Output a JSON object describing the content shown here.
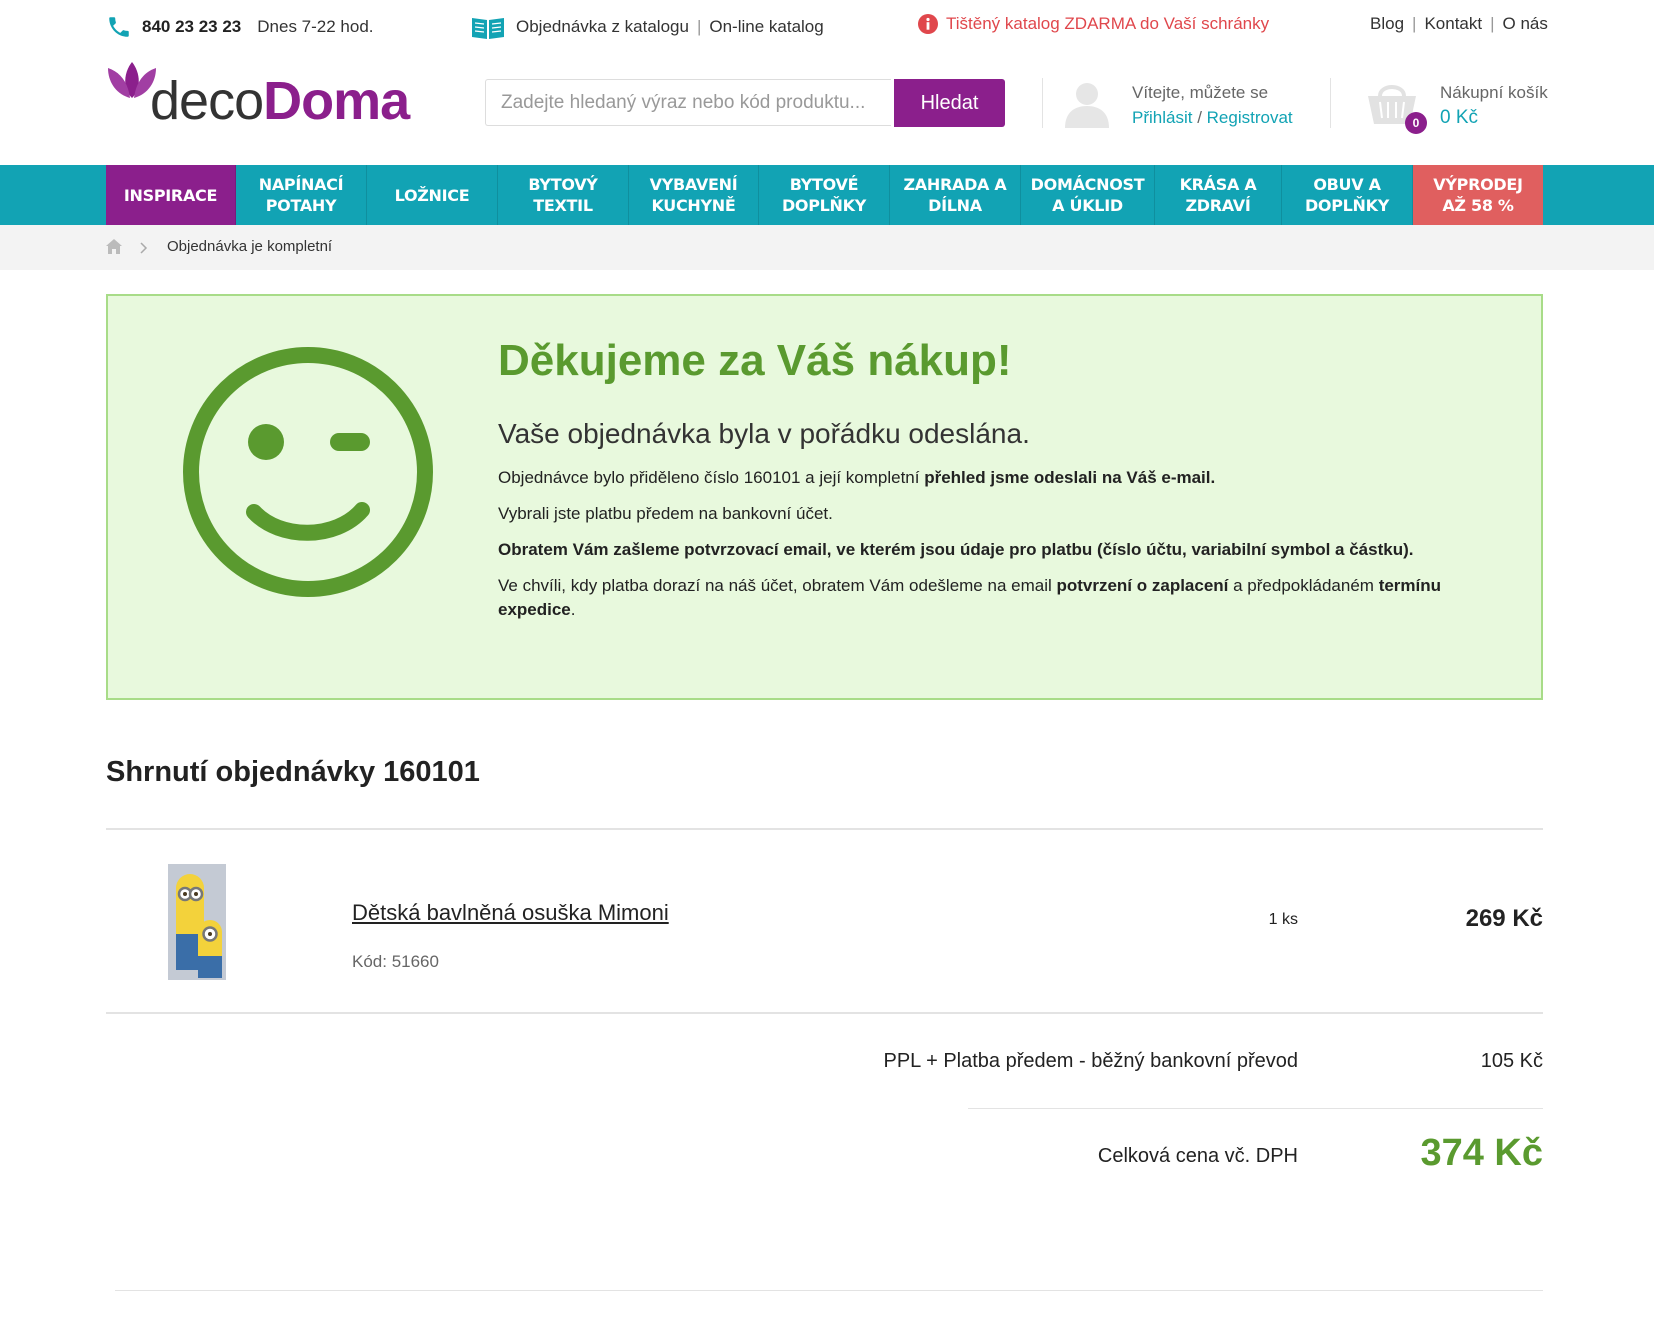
{
  "topbar": {
    "phone": "840 23 23 23",
    "hours": "Dnes 7-22 hod.",
    "catalog_order": "Objednávka z katalogu",
    "online_catalog": "On-line katalog",
    "promo": "Tištěný katalog ZDARMA do Vaší schránky",
    "links": [
      "Blog",
      "Kontakt",
      "O nás"
    ]
  },
  "header": {
    "logo_part1": "deco",
    "logo_part2": "Doma",
    "search_placeholder": "Zadejte hledaný výraz nebo kód produktu...",
    "search_button": "Hledat",
    "welcome": "Vítejte, můžete se",
    "login": "Přihlásit",
    "register": "Registrovat",
    "cart_label": "Nákupní košík",
    "cart_sum": "0 Kč",
    "cart_count": "0"
  },
  "nav": [
    {
      "label": "INSPIRACE"
    },
    {
      "label": "NAPÍNACÍ POTAHY"
    },
    {
      "label": "LOŽNICE"
    },
    {
      "label": "BYTOVÝ TEXTIL"
    },
    {
      "label": "VYBAVENÍ KUCHYNĚ"
    },
    {
      "label": "BYTOVÉ DOPLŇKY"
    },
    {
      "label": "ZAHRADA A DÍLNA"
    },
    {
      "label": "DOMÁCNOST A ÚKLID"
    },
    {
      "label": "KRÁSA A ZDRAVÍ"
    },
    {
      "label": "OBUV A DOPLŇKY"
    },
    {
      "label": "VÝPRODEJ AŽ 58 %"
    }
  ],
  "breadcrumb": {
    "current": "Objednávka je kompletní"
  },
  "success": {
    "title": "Děkujeme za Váš nákup!",
    "subtitle": "Vaše objednávka byla v pořádku odeslána.",
    "p1_a": "Objednávce bylo přiděleno číslo 160101 a její kompletní ",
    "p1_b": "přehled jsme odeslali na Váš e-mail.",
    "p2": "Vybrali jste platbu předem na bankovní účet.",
    "p3": "Obratem Vám zašleme potvrzovací email, ve kterém jsou údaje pro platbu (číslo účtu, variabilní symbol a částku).",
    "p4_a": "Ve chvíli, kdy platba dorazí na náš účet, obratem Vám odešleme na email ",
    "p4_b": "potvrzení o zaplacení",
    "p4_c": " a předpokládaném ",
    "p4_d": "termínu expedice",
    "p4_e": "."
  },
  "summary": {
    "title": "Shrnutí objednávky 160101",
    "item_name": "Dětská bavlněná osuška Mimoni",
    "item_code": "Kód: 51660",
    "item_qty": "1 ks",
    "item_price": "269 Kč",
    "shipping_label": "PPL + Platba předem - běžný bankovní převod",
    "shipping_price": "105 Kč",
    "total_label": "Celková cena vč. DPH",
    "total_price": "374 Kč"
  },
  "colors": {
    "brand_purple": "#8b1f8c",
    "teal": "#12a3b4",
    "success_green": "#5a9a2f",
    "sale_red": "#e05f5f"
  }
}
